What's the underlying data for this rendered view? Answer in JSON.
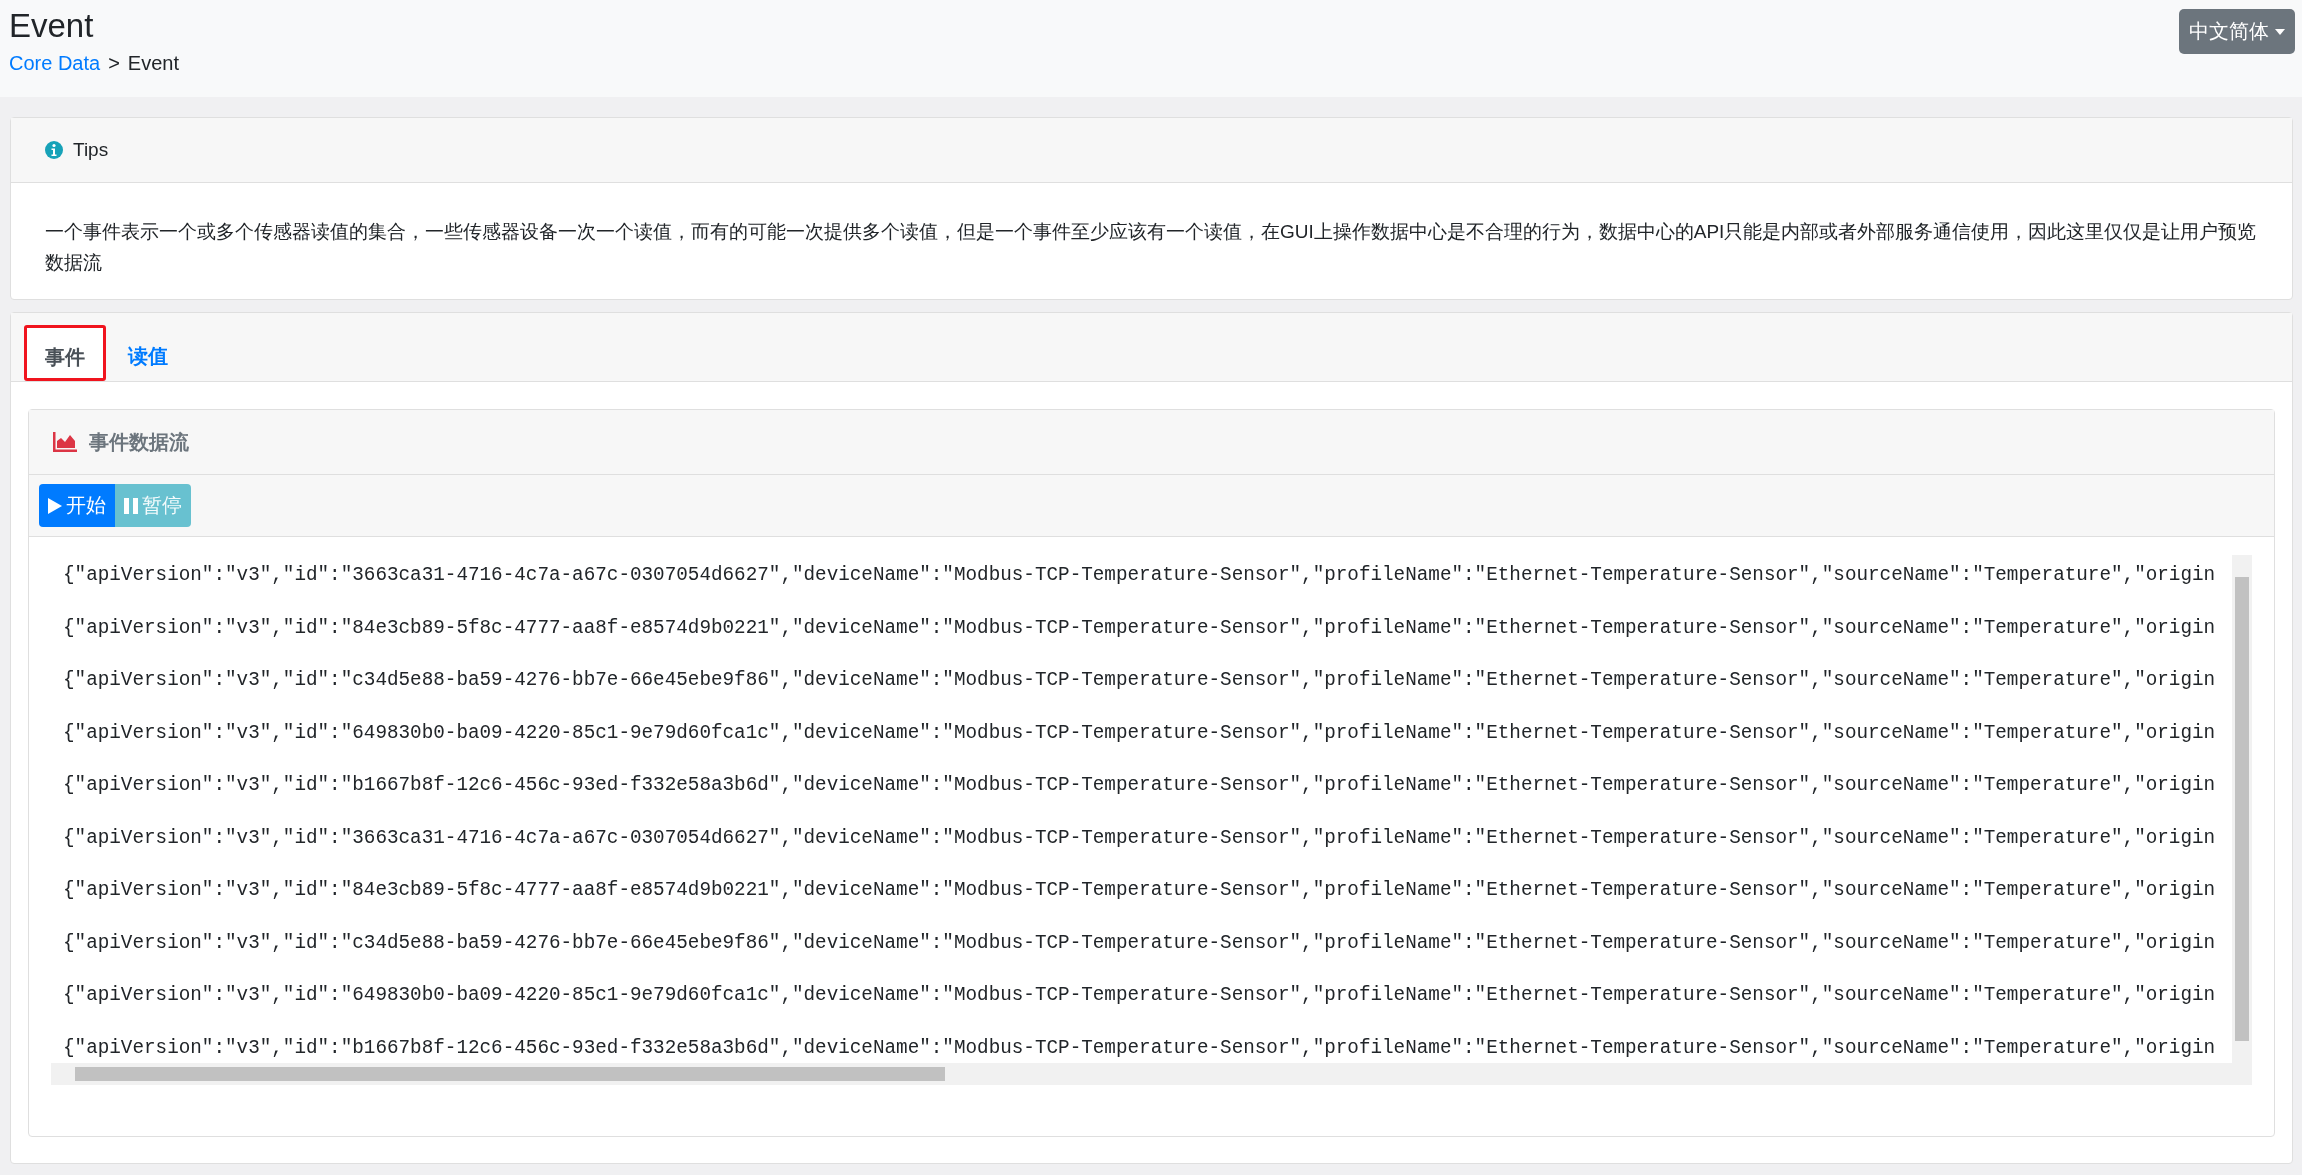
{
  "header": {
    "title": "Event",
    "breadcrumb": [
      {
        "label": "Core Data",
        "link": true
      },
      {
        "label": "Event",
        "link": false
      }
    ],
    "separator": ">",
    "language": "中文简体"
  },
  "tips": {
    "title": "Tips",
    "text": "一个事件表示一个或多个传感器读值的集合，一些传感器设备一次一个读值，而有的可能一次提供多个读值，但是一个事件至少应该有一个读值，在GUI上操作数据中心是不合理的行为，数据中心的API只能是内部或者外部服务通信使用，因此这里仅仅是让用户预览数据流"
  },
  "tabs": [
    {
      "label": "事件",
      "selected": true
    },
    {
      "label": "读值",
      "selected": false
    }
  ],
  "stream": {
    "title": "事件数据流",
    "buttons": [
      {
        "kind": "start",
        "label": "开始"
      },
      {
        "kind": "pause",
        "label": "暂停"
      }
    ],
    "lines": [
      "{\"apiVersion\":\"v3\",\"id\":\"3663ca31-4716-4c7a-a67c-0307054d6627\",\"deviceName\":\"Modbus-TCP-Temperature-Sensor\",\"profileName\":\"Ethernet-Temperature-Sensor\",\"sourceName\":\"Temperature\",\"origin",
      "{\"apiVersion\":\"v3\",\"id\":\"84e3cb89-5f8c-4777-aa8f-e8574d9b0221\",\"deviceName\":\"Modbus-TCP-Temperature-Sensor\",\"profileName\":\"Ethernet-Temperature-Sensor\",\"sourceName\":\"Temperature\",\"origin",
      "{\"apiVersion\":\"v3\",\"id\":\"c34d5e88-ba59-4276-bb7e-66e45ebe9f86\",\"deviceName\":\"Modbus-TCP-Temperature-Sensor\",\"profileName\":\"Ethernet-Temperature-Sensor\",\"sourceName\":\"Temperature\",\"origin",
      "{\"apiVersion\":\"v3\",\"id\":\"649830b0-ba09-4220-85c1-9e79d60fca1c\",\"deviceName\":\"Modbus-TCP-Temperature-Sensor\",\"profileName\":\"Ethernet-Temperature-Sensor\",\"sourceName\":\"Temperature\",\"origin",
      "{\"apiVersion\":\"v3\",\"id\":\"b1667b8f-12c6-456c-93ed-f332e58a3b6d\",\"deviceName\":\"Modbus-TCP-Temperature-Sensor\",\"profileName\":\"Ethernet-Temperature-Sensor\",\"sourceName\":\"Temperature\",\"origin",
      "{\"apiVersion\":\"v3\",\"id\":\"3663ca31-4716-4c7a-a67c-0307054d6627\",\"deviceName\":\"Modbus-TCP-Temperature-Sensor\",\"profileName\":\"Ethernet-Temperature-Sensor\",\"sourceName\":\"Temperature\",\"origin",
      "{\"apiVersion\":\"v3\",\"id\":\"84e3cb89-5f8c-4777-aa8f-e8574d9b0221\",\"deviceName\":\"Modbus-TCP-Temperature-Sensor\",\"profileName\":\"Ethernet-Temperature-Sensor\",\"sourceName\":\"Temperature\",\"origin",
      "{\"apiVersion\":\"v3\",\"id\":\"c34d5e88-ba59-4276-bb7e-66e45ebe9f86\",\"deviceName\":\"Modbus-TCP-Temperature-Sensor\",\"profileName\":\"Ethernet-Temperature-Sensor\",\"sourceName\":\"Temperature\",\"origin",
      "{\"apiVersion\":\"v3\",\"id\":\"649830b0-ba09-4220-85c1-9e79d60fca1c\",\"deviceName\":\"Modbus-TCP-Temperature-Sensor\",\"profileName\":\"Ethernet-Temperature-Sensor\",\"sourceName\":\"Temperature\",\"origin",
      "{\"apiVersion\":\"v3\",\"id\":\"b1667b8f-12c6-456c-93ed-f332e58a3b6d\",\"deviceName\":\"Modbus-TCP-Temperature-Sensor\",\"profileName\":\"Ethernet-Temperature-Sensor\",\"sourceName\":\"Temperature\",\"origin"
    ]
  }
}
